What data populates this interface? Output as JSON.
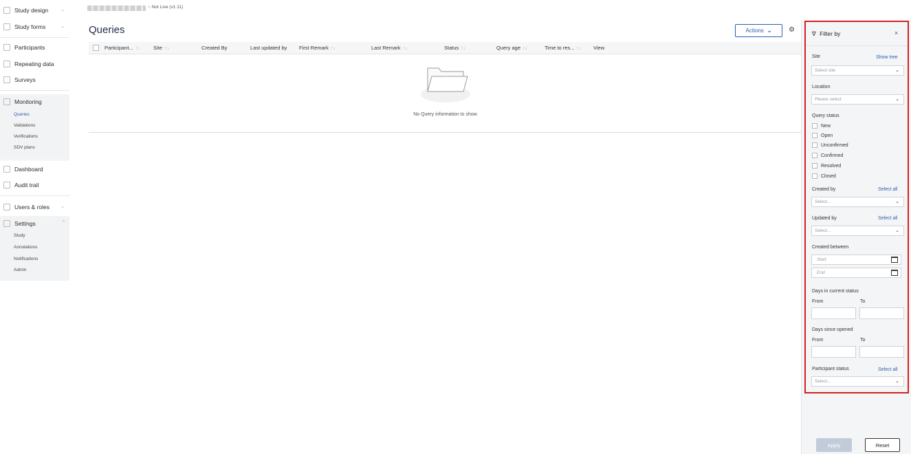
{
  "study": {
    "status": "○ Not Live (v1.11)"
  },
  "sidebar": {
    "items": [
      {
        "label": "Study design",
        "chevron": "⌄"
      },
      {
        "label": "Study forms",
        "chevron": "⌄"
      },
      {
        "label": "Participants"
      },
      {
        "label": "Repeating data"
      },
      {
        "label": "Surveys"
      },
      {
        "label": "Monitoring"
      },
      {
        "label": "Dashboard"
      },
      {
        "label": "Audit trail"
      },
      {
        "label": "Users & roles",
        "chevron": "⌄"
      },
      {
        "label": "Settings",
        "chevron": "^"
      }
    ],
    "monitoring_sub": [
      "Queries",
      "Validations",
      "Verifications",
      "SDV plans"
    ],
    "settings_sub": [
      "Study",
      "Annotations",
      "Notifications",
      "Admin"
    ]
  },
  "main": {
    "title": "Queries",
    "actions_label": "Actions",
    "actions_icon": "⌄",
    "settings_icon": "⚙",
    "columns": [
      {
        "label": "Participant...",
        "sort": "↑↓"
      },
      {
        "label": "Site",
        "sort": "↑↓"
      },
      {
        "label": "Created By"
      },
      {
        "label": "Last updated by"
      },
      {
        "label": "First Remark",
        "sort": "↑↓"
      },
      {
        "label": "Last Remark",
        "sort": "↑↓"
      },
      {
        "label": "Status",
        "sort": "↑↓"
      },
      {
        "label": "Query age",
        "sort": "↑↓"
      },
      {
        "label": "Time to res...",
        "sort": "↑↓"
      },
      {
        "label": "View"
      }
    ],
    "empty_text": "No Query information to show"
  },
  "filter": {
    "title": "Filter by",
    "filter_icon": "∇",
    "close_icon": "×",
    "site": {
      "label": "Site",
      "link": "Show tree",
      "placeholder": "Select site"
    },
    "location": {
      "label": "Location",
      "placeholder": "Please select"
    },
    "query_status": {
      "label": "Query status",
      "options": [
        "New",
        "Open",
        "Unconfirmed",
        "Confirmed",
        "Resolved",
        "Closed"
      ]
    },
    "created_by": {
      "label": "Created by",
      "link": "Select all",
      "placeholder": "Select..."
    },
    "updated_by": {
      "label": "Updated by",
      "link": "Select all",
      "placeholder": "Select..."
    },
    "created_between": {
      "label": "Created between",
      "start": "Start",
      "end": "End"
    },
    "days_current": {
      "label": "Days in current status",
      "from": "From",
      "to": "To"
    },
    "days_opened": {
      "label": "Days since opened",
      "from": "From",
      "to": "To"
    },
    "participant_status": {
      "label": "Participant status",
      "link": "Select all",
      "placeholder": "Select..."
    },
    "caret": "⌄",
    "apply_label": "Apply",
    "reset_label": "Reset"
  },
  "colors": {
    "accent": "#2a5db0",
    "highlight": "#d21f1f",
    "apply_disabled": "#c2cbd9"
  }
}
